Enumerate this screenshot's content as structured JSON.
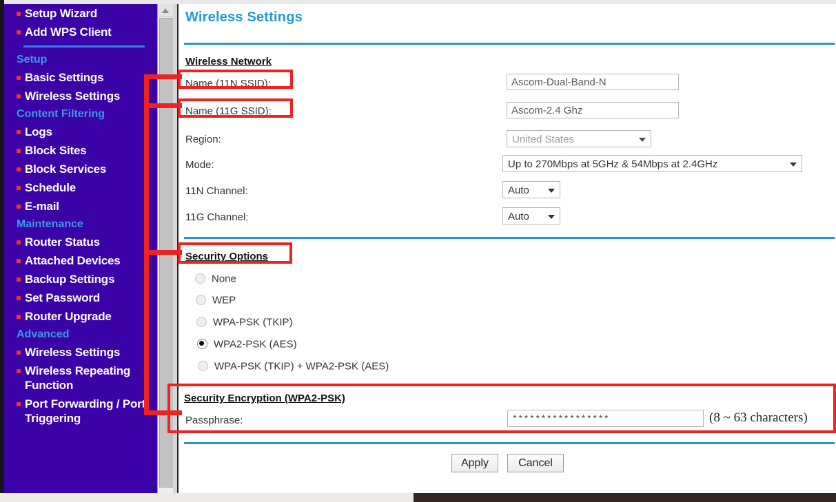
{
  "sidebar": {
    "items": [
      {
        "type": "link",
        "label": "Setup Wizard"
      },
      {
        "type": "link",
        "label": "Add WPS Client"
      },
      {
        "type": "sep",
        "label": ""
      },
      {
        "type": "heading",
        "label": "Setup"
      },
      {
        "type": "link",
        "label": "Basic Settings"
      },
      {
        "type": "link",
        "label": "Wireless Settings"
      },
      {
        "type": "heading",
        "label": "Content Filtering"
      },
      {
        "type": "link",
        "label": "Logs"
      },
      {
        "type": "link",
        "label": "Block Sites"
      },
      {
        "type": "link",
        "label": "Block Services"
      },
      {
        "type": "link",
        "label": "Schedule"
      },
      {
        "type": "link",
        "label": "E-mail"
      },
      {
        "type": "heading",
        "label": "Maintenance"
      },
      {
        "type": "link",
        "label": "Router Status"
      },
      {
        "type": "link",
        "label": "Attached Devices"
      },
      {
        "type": "link",
        "label": "Backup Settings"
      },
      {
        "type": "link",
        "label": "Set Password"
      },
      {
        "type": "link",
        "label": "Router Upgrade"
      },
      {
        "type": "heading",
        "label": "Advanced"
      },
      {
        "type": "link",
        "label": "Wireless Settings"
      },
      {
        "type": "link",
        "label": "Wireless Repeating Function"
      },
      {
        "type": "link",
        "label": "Port Forwarding / Port Triggering"
      }
    ]
  },
  "page": {
    "title": "Wireless Settings"
  },
  "wireless_network": {
    "heading": "Wireless Network",
    "ssid_11n": {
      "label": "Name (11N SSID):",
      "value": "Ascom-Dual-Band-N"
    },
    "ssid_11g": {
      "label": "Name (11G SSID):",
      "value": "Ascom-2.4 Ghz"
    },
    "region": {
      "label": "Region:",
      "value": "United States"
    },
    "mode": {
      "label": "Mode:",
      "value": "Up to 270Mbps at 5GHz & 54Mbps at 2.4GHz"
    },
    "channel_11n": {
      "label": "11N Channel:",
      "value": "Auto"
    },
    "channel_11g": {
      "label": "11G Channel:",
      "value": "Auto"
    }
  },
  "security_options": {
    "heading": "Security Options",
    "options": [
      {
        "label": "None",
        "selected": false
      },
      {
        "label": "WEP",
        "selected": false
      },
      {
        "label": "WPA-PSK (TKIP)",
        "selected": false
      },
      {
        "label": "WPA2-PSK (AES)",
        "selected": true
      },
      {
        "label": "WPA-PSK (TKIP) + WPA2-PSK (AES)",
        "selected": false
      }
    ]
  },
  "security_encryption": {
    "heading": "Security Encryption (WPA2-PSK)",
    "passphrase": {
      "label": "Passphrase:",
      "value": "*****************",
      "hint": "(8 ~ 63 characters)"
    }
  },
  "actions": {
    "apply": "Apply",
    "cancel": "Cancel"
  },
  "colors": {
    "sidebar_bg": "#3b02a8",
    "sidebar_heading": "#3b9ae3",
    "bullet": "#ff2d2d",
    "title": "#1f9cd0",
    "rule": "#2196d8",
    "annotation": "#ef2222"
  }
}
